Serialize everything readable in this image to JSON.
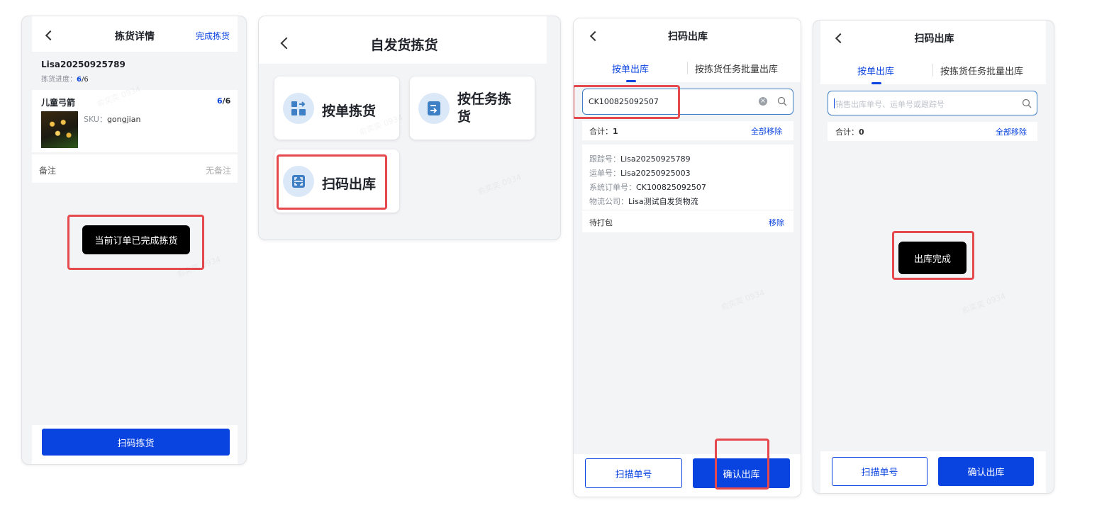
{
  "panel1": {
    "title": "拣货详情",
    "complete_link": "完成拣货",
    "order_no": "Lisa20250925789",
    "progress_label": "拣货进度：",
    "progress_done": "6",
    "progress_total": "/6",
    "item_name": "儿童弓箭",
    "item_done": "6",
    "item_total": "/6",
    "sku_label": "SKU：",
    "sku_value": "gongjian",
    "remark_label": "备注",
    "remark_value": "无备注",
    "toast": "当前订单已完成拣货",
    "scan_button": "扫码拣货"
  },
  "panel2": {
    "title": "自发货拣货",
    "cards": [
      {
        "label": "按单拣货"
      },
      {
        "label": "按任务拣\n货"
      },
      {
        "label": "扫码出库"
      }
    ]
  },
  "panel3": {
    "title": "扫码出库",
    "tabs": [
      "按单出库",
      "按拣货任务批量出库"
    ],
    "search_value": "CK100825092507",
    "total_label": "合计：",
    "total_value": "1",
    "remove_all": "全部移除",
    "tracking_label": "跟踪号：",
    "tracking_value": "Lisa20250925789",
    "waybill_label": "运单号：",
    "waybill_value": "Lisa20250925003",
    "sys_order_label": "系统订单号：",
    "sys_order_value": "CK100825092507",
    "logistics_label": "物流公司：",
    "logistics_value": "Lisa测试自发货物流",
    "status": "待打包",
    "remove": "移除",
    "scan_button": "扫描单号",
    "confirm_button": "确认出库"
  },
  "panel4": {
    "title": "扫码出库",
    "tabs": [
      "按单出库",
      "按拣货任务批量出库"
    ],
    "search_placeholder": "销售出库单号、运单号或跟踪号",
    "total_label": "合计：",
    "total_value": "0",
    "remove_all": "全部移除",
    "toast": "出库完成",
    "scan_button": "扫描单号",
    "confirm_button": "确认出库"
  },
  "watermark": "俞奕奕 0934",
  "colors": {
    "accent": "#0a44e0",
    "highlight": "#e5484d",
    "icon_bg": "#dbe8f7",
    "icon_fg": "#3f7fc6"
  }
}
